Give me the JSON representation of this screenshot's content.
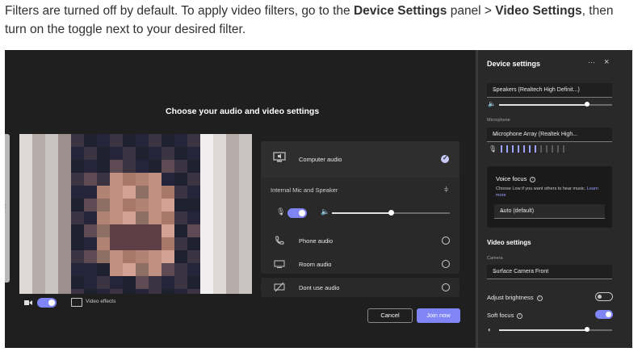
{
  "doc": {
    "line1_pre": "Filters are turned off by default. To apply video filters, go to the ",
    "line1_bold1": "Device Settings",
    "line1_mid": " panel > ",
    "line1_bold2": "Video Settings",
    "line1_post": ", then",
    "line2": "turn on the toggle next to your desired filter."
  },
  "prejoin": {
    "heading": "Choose your audio and video settings",
    "video_effects_label": "Video effects",
    "camera_on": true,
    "audio_options": [
      {
        "label": "Computer audio",
        "icon": "computer-audio-icon",
        "selected": true
      },
      {
        "label": "Phone audio",
        "icon": "phone-icon",
        "selected": false
      },
      {
        "label": "Room audio",
        "icon": "room-icon",
        "selected": false
      },
      {
        "label": "Dont use audio",
        "icon": "no-audio-icon",
        "selected": false
      }
    ],
    "mic_speaker_label": "Internal Mic and Speaker",
    "mic_on": true,
    "speaker_volume": 0.5,
    "cancel_label": "Cancel",
    "join_label": "Join now"
  },
  "device_settings": {
    "title": "Device settings",
    "more_icon": "···",
    "close_icon": "×",
    "speaker_value": "Speakers (Realtech High Definit...)",
    "speaker_volume": 0.78,
    "microphone_label": "Microphone",
    "microphone_value": "Microphone Array (Realtek High...",
    "mic_level_bars": 12,
    "mic_level_active": 7,
    "voice_focus": {
      "title": "Voice focus",
      "desc": "Choose Low if you want others to hear music.",
      "learn_more": "Learn more",
      "value": "Auto (default)"
    },
    "video_settings_title": "Video settings",
    "camera_label": "Camera",
    "camera_value": "Surface Camera Front",
    "adjust_brightness_label": "Adjust brightness",
    "adjust_brightness_on": false,
    "soft_focus_label": "Soft focus",
    "soft_focus_on": true,
    "soft_focus_level": 0.78
  },
  "colors": {
    "accent": "#7f85f5",
    "panel_bg": "#292929",
    "screen_bg": "#1f1f1f"
  }
}
